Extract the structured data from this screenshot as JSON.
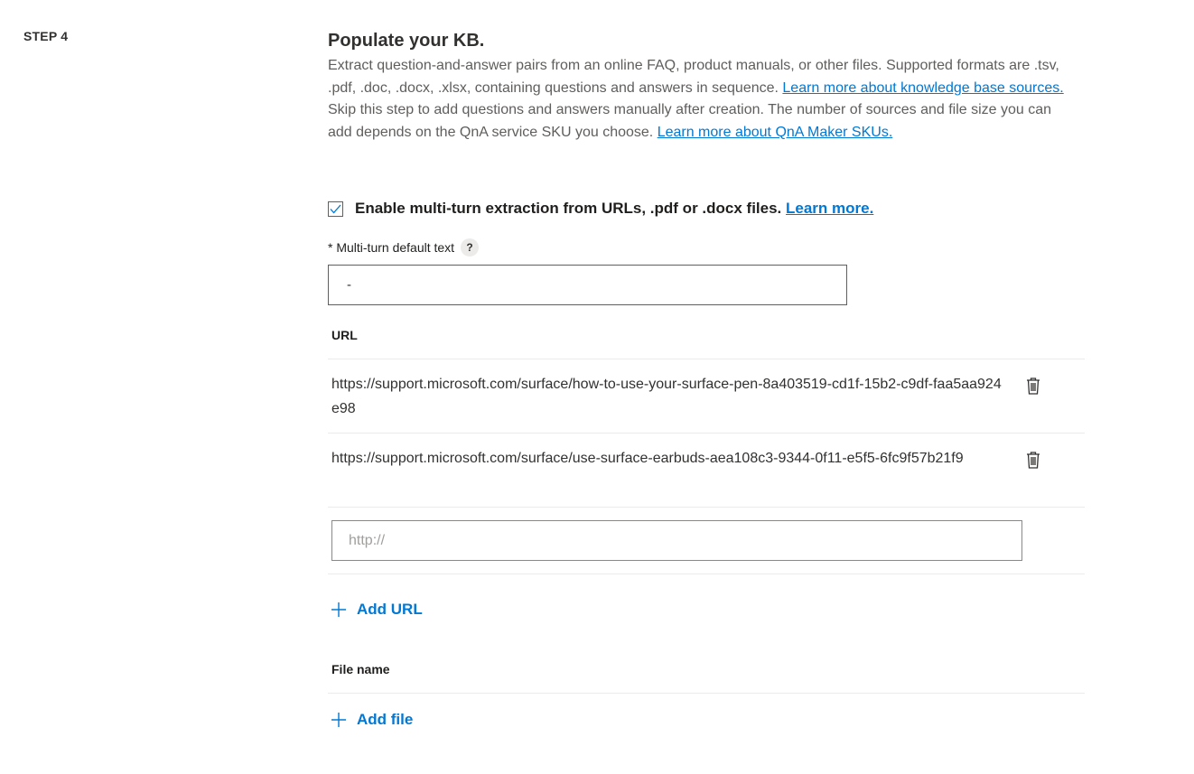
{
  "step": {
    "label": "STEP 4"
  },
  "section": {
    "title": "Populate your KB.",
    "description_part1": "Extract question-and-answer pairs from an online FAQ, product manuals, or other files. Supported formats are .tsv, .pdf, .doc, .docx, .xlsx, containing questions and answers in sequence. ",
    "link_kb_sources": "Learn more about knowledge base sources.",
    "description_part2": " Skip this step to add questions and answers manually after creation. The number of sources and file size you can add depends on the QnA service SKU you choose. ",
    "link_skus": "Learn more about QnA Maker SKUs."
  },
  "multiturn": {
    "checkbox_label": "Enable multi-turn extraction from URLs, .pdf or .docx files.",
    "checked": true,
    "learn_more": "Learn more.",
    "default_text_label": "* Multi-turn default text",
    "help_glyph": "?",
    "default_text_value": "-"
  },
  "urls": {
    "header": "URL",
    "items": [
      {
        "url": "https://support.microsoft.com/surface/how-to-use-your-surface-pen-8a403519-cd1f-15b2-c9df-faa5aa924e98"
      },
      {
        "url": "https://support.microsoft.com/surface/use-surface-earbuds-aea108c3-9344-0f11-e5f5-6fc9f57b21f9"
      }
    ],
    "input_placeholder": "http://",
    "add_label": "Add URL"
  },
  "files": {
    "header": "File name",
    "add_label": "Add file"
  },
  "colors": {
    "accent": "#0078d4",
    "text": "#323130",
    "muted": "#605e5c",
    "divider": "#edebe9"
  }
}
